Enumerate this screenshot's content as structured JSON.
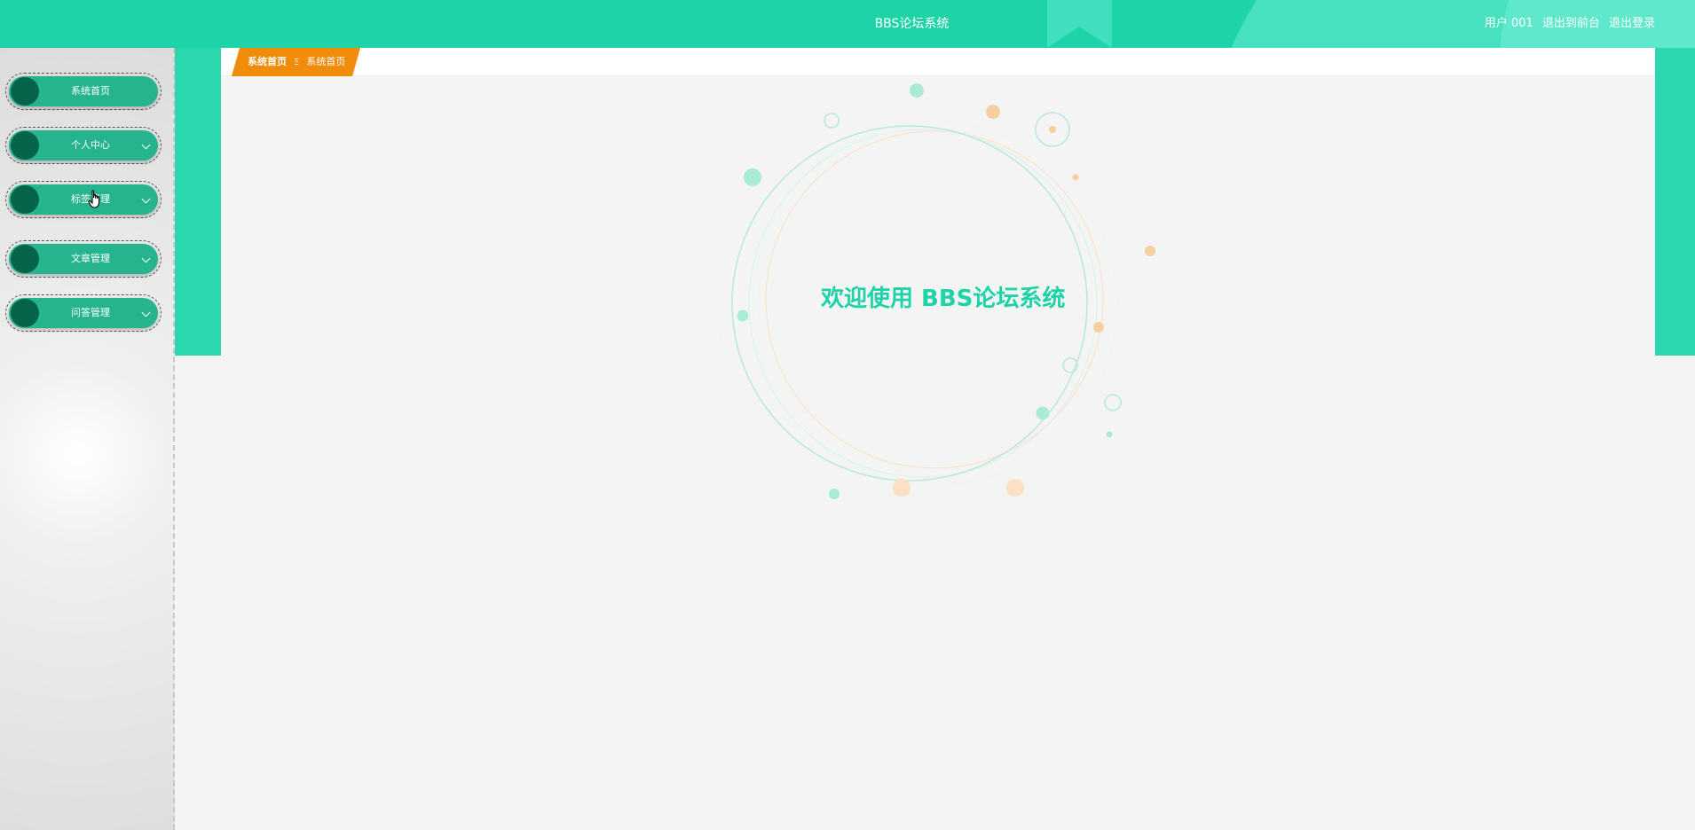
{
  "header": {
    "title": "BBS论坛系统",
    "user": "用户 001",
    "back_to_front": "退出到前台",
    "logout": "退出登录"
  },
  "sidebar": {
    "items": [
      {
        "label": "系统首页",
        "has_submenu": false
      },
      {
        "label": "个人中心",
        "has_submenu": true
      },
      {
        "label": "标签管理",
        "has_submenu": true
      },
      {
        "label": "文章管理",
        "has_submenu": true
      },
      {
        "label": "问答管理",
        "has_submenu": true
      }
    ]
  },
  "breadcrumb": {
    "home": "系统首页",
    "separator": "Ξ",
    "current": "系统首页"
  },
  "main": {
    "welcome": "欢迎使用 BBS论坛系统"
  },
  "colors": {
    "accent": "#1ed3a8",
    "menu_bg": "#25b48e",
    "menu_knob": "#05634a",
    "breadcrumb_bg": "#f08c0a"
  }
}
